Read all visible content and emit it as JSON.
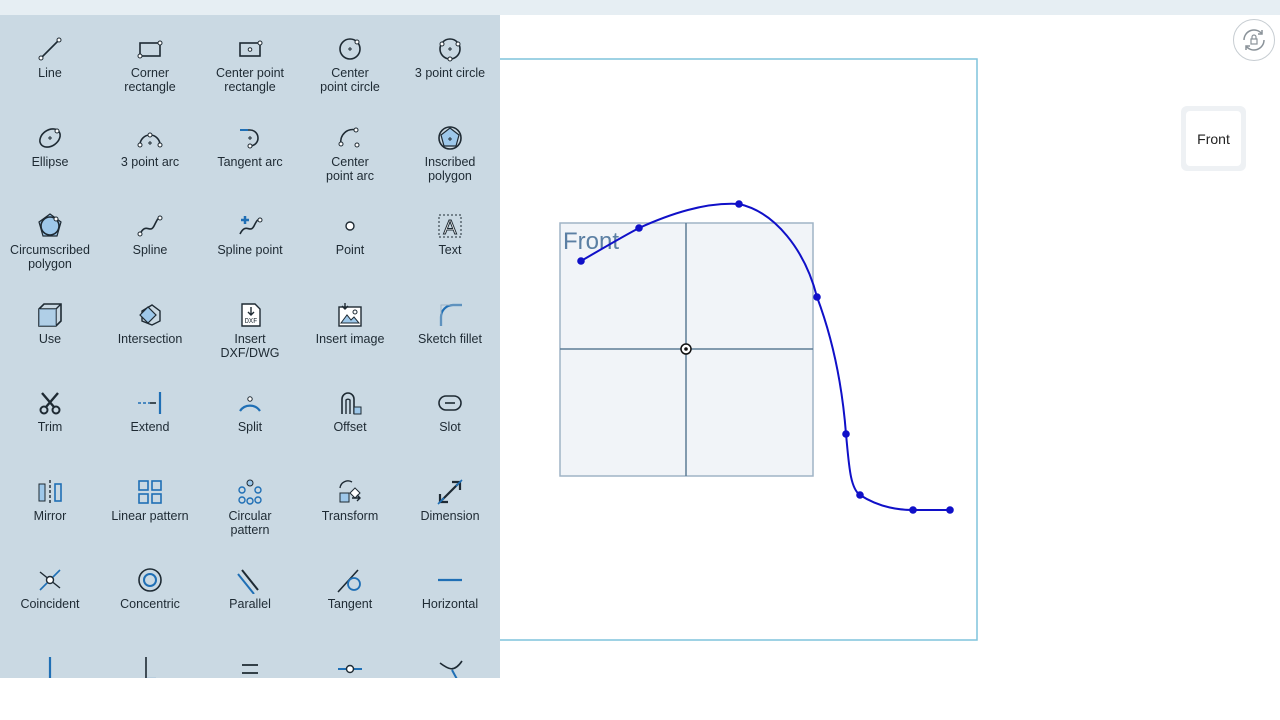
{
  "canvas": {
    "plane_label": "Front",
    "view_cube_face": "Front"
  },
  "view_controls": {
    "orient_icon": "rotate-lock-icon"
  },
  "palette": {
    "tools": [
      {
        "label": "Line",
        "icon": "line-icon"
      },
      {
        "label": "Corner\nrectangle",
        "icon": "corner-rectangle-icon"
      },
      {
        "label": "Center point\nrectangle",
        "icon": "center-point-rectangle-icon"
      },
      {
        "label": "Center\npoint circle",
        "icon": "center-point-circle-icon"
      },
      {
        "label": "3 point circle",
        "icon": "three-point-circle-icon"
      },
      {
        "label": "Ellipse",
        "icon": "ellipse-icon"
      },
      {
        "label": "3 point arc",
        "icon": "three-point-arc-icon"
      },
      {
        "label": "Tangent arc",
        "icon": "tangent-arc-icon"
      },
      {
        "label": "Center\npoint arc",
        "icon": "center-point-arc-icon"
      },
      {
        "label": "Inscribed\npolygon",
        "icon": "inscribed-polygon-icon"
      },
      {
        "label": "Circumscribed\npolygon",
        "icon": "circumscribed-polygon-icon"
      },
      {
        "label": "Spline",
        "icon": "spline-icon"
      },
      {
        "label": "Spline point",
        "icon": "spline-point-icon"
      },
      {
        "label": "Point",
        "icon": "point-icon"
      },
      {
        "label": "Text",
        "icon": "text-icon"
      },
      {
        "label": "Use",
        "icon": "use-icon"
      },
      {
        "label": "Intersection",
        "icon": "intersection-icon"
      },
      {
        "label": "Insert\nDXF/DWG",
        "icon": "insert-dxf-icon"
      },
      {
        "label": "Insert image",
        "icon": "insert-image-icon"
      },
      {
        "label": "Sketch fillet",
        "icon": "sketch-fillet-icon"
      },
      {
        "label": "Trim",
        "icon": "trim-icon"
      },
      {
        "label": "Extend",
        "icon": "extend-icon"
      },
      {
        "label": "Split",
        "icon": "split-icon"
      },
      {
        "label": "Offset",
        "icon": "offset-icon"
      },
      {
        "label": "Slot",
        "icon": "slot-icon"
      },
      {
        "label": "Mirror",
        "icon": "mirror-icon"
      },
      {
        "label": "Linear pattern",
        "icon": "linear-pattern-icon"
      },
      {
        "label": "Circular\npattern",
        "icon": "circular-pattern-icon"
      },
      {
        "label": "Transform",
        "icon": "transform-icon"
      },
      {
        "label": "Dimension",
        "icon": "dimension-icon"
      },
      {
        "label": "Coincident",
        "icon": "coincident-icon"
      },
      {
        "label": "Concentric",
        "icon": "concentric-icon"
      },
      {
        "label": "Parallel",
        "icon": "parallel-icon"
      },
      {
        "label": "Tangent",
        "icon": "tangent-icon"
      },
      {
        "label": "Horizontal",
        "icon": "horizontal-icon"
      },
      {
        "label": "",
        "icon": "vertical-icon"
      },
      {
        "label": "",
        "icon": "perpendicular-icon"
      },
      {
        "label": "",
        "icon": "equal-icon"
      },
      {
        "label": "",
        "icon": "midpoint-icon"
      },
      {
        "label": "",
        "icon": "normal-icon"
      }
    ]
  },
  "colors": {
    "palette_bg": "#cad9e3",
    "accent": "#1f6fb5",
    "spline": "#1010c8",
    "plane_border": "#7fc3dc"
  }
}
